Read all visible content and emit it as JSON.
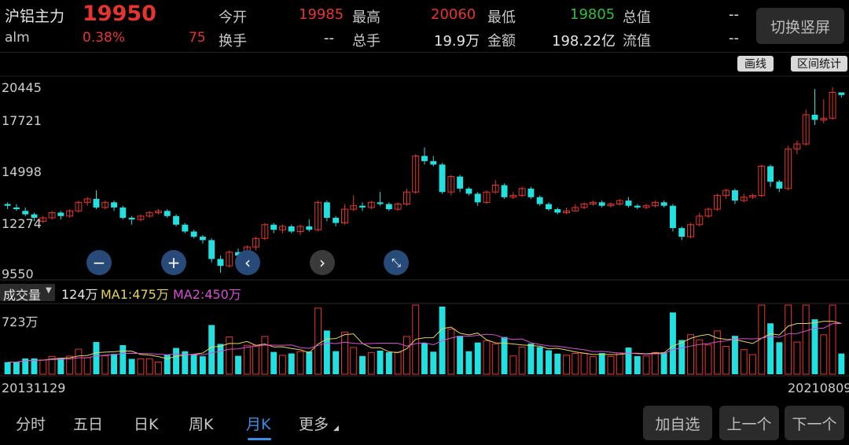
{
  "header": {
    "name": "沪铝主力",
    "price": "19950",
    "code": "alm",
    "change_pct": "0.38%",
    "change_val": "75",
    "switch_label": "切换竖屏"
  },
  "stats": {
    "open_label": "今开",
    "open": "19985",
    "high_label": "最高",
    "high": "20060",
    "low_label": "最低",
    "low": "19805",
    "total_value_label": "总值",
    "total_value": "--",
    "turnover_label": "换手",
    "turnover": "--",
    "total_hand_label": "总手",
    "total_hand": "19.9万",
    "amount_label": "金额",
    "amount": "198.22亿",
    "float_value_label": "流值",
    "float_value": "--"
  },
  "tools": {
    "draw": "画线",
    "range": "区间统计"
  },
  "volume_bar": {
    "selector": "成交量",
    "vol": "124万",
    "ma1": "MA1:475万",
    "ma2": "MA2:450万"
  },
  "y_ticks": [
    "20445",
    "17721",
    "14998",
    "12274",
    "9550"
  ],
  "vol_tick": "723万",
  "date_start": "20131129",
  "date_end": "20210809",
  "tabs": [
    "分时",
    "五日",
    "日K",
    "周K",
    "月K",
    "更多"
  ],
  "actions": {
    "add_watch": "加自选",
    "prev": "上一个",
    "next": "下一个"
  },
  "colors": {
    "up": "#e8342f",
    "down": "#22e0e0",
    "ma1": "#e6d35a",
    "ma2": "#d94fd6",
    "active_tab": "#3a8ee6"
  },
  "icons": [
    "minus-icon",
    "plus-icon",
    "chevron-left-icon",
    "chevron-right-icon",
    "collapse-icon"
  ],
  "chart_data": {
    "type": "candlestick",
    "y_range": [
      9550,
      20445
    ],
    "candles": [
      [
        13600,
        13500,
        13700,
        13300
      ],
      [
        13400,
        13300,
        13600,
        13200
      ],
      [
        13200,
        13000,
        13400,
        12900
      ],
      [
        13000,
        12800,
        13100,
        12600
      ],
      [
        12600,
        12800,
        12900,
        12500
      ],
      [
        12800,
        13100,
        13200,
        12700
      ],
      [
        13100,
        12900,
        13200,
        12700
      ],
      [
        12900,
        13200,
        13300,
        12800
      ],
      [
        13200,
        13700,
        13800,
        13100
      ],
      [
        13700,
        13900,
        14000,
        13500
      ],
      [
        13900,
        13400,
        14400,
        13300
      ],
      [
        13400,
        13700,
        13800,
        13300
      ],
      [
        13700,
        13400,
        13800,
        13200
      ],
      [
        13400,
        12800,
        13500,
        12700
      ],
      [
        12800,
        12700,
        12900,
        12400
      ],
      [
        12700,
        12900,
        13000,
        12600
      ],
      [
        12900,
        13100,
        13200,
        12800
      ],
      [
        13100,
        13200,
        13300,
        13000
      ],
      [
        13200,
        12900,
        13300,
        12800
      ],
      [
        12900,
        12400,
        13000,
        12300
      ],
      [
        12400,
        12000,
        12500,
        11900
      ],
      [
        12000,
        11700,
        12100,
        11600
      ],
      [
        11700,
        11500,
        11800,
        11300
      ],
      [
        11500,
        10400,
        11600,
        10200
      ],
      [
        10400,
        10000,
        10600,
        9600
      ],
      [
        10000,
        10800,
        10900,
        9900
      ],
      [
        10800,
        10600,
        11000,
        10500
      ],
      [
        10600,
        11100,
        11200,
        10400
      ],
      [
        11100,
        11600,
        11700,
        10900
      ],
      [
        11600,
        12400,
        12500,
        11500
      ],
      [
        12400,
        12100,
        12500,
        11900
      ],
      [
        12100,
        12300,
        12400,
        11900
      ],
      [
        12300,
        12000,
        12400,
        11900
      ],
      [
        12000,
        12300,
        12400,
        11800
      ],
      [
        12300,
        12100,
        12700,
        12000
      ],
      [
        12100,
        13700,
        13800,
        12000
      ],
      [
        13700,
        12800,
        13800,
        12600
      ],
      [
        12800,
        12500,
        12900,
        12300
      ],
      [
        12500,
        13300,
        13600,
        12400
      ],
      [
        13300,
        13500,
        14100,
        13200
      ],
      [
        13500,
        13400,
        13700,
        13200
      ],
      [
        13400,
        13700,
        13800,
        13300
      ],
      [
        13700,
        13600,
        14300,
        13500
      ],
      [
        13600,
        13300,
        13700,
        13200
      ],
      [
        13300,
        13600,
        13700,
        13200
      ],
      [
        13600,
        14300,
        14500,
        13500
      ],
      [
        14300,
        16400,
        16500,
        14200
      ],
      [
        16400,
        16100,
        16900,
        15900
      ],
      [
        16100,
        15900,
        16400,
        15800
      ],
      [
        15900,
        14300,
        16000,
        14200
      ],
      [
        14300,
        15200,
        15300,
        14100
      ],
      [
        15200,
        14500,
        15300,
        14300
      ],
      [
        14500,
        14200,
        14600,
        14100
      ],
      [
        14200,
        13700,
        14300,
        13500
      ],
      [
        13700,
        14300,
        14400,
        13600
      ],
      [
        14300,
        14700,
        15000,
        14200
      ],
      [
        14700,
        14000,
        14800,
        13900
      ],
      [
        14000,
        14100,
        14300,
        13900
      ],
      [
        14100,
        14500,
        14600,
        14000
      ],
      [
        14500,
        14000,
        14600,
        13900
      ],
      [
        14000,
        13600,
        14100,
        13500
      ],
      [
        13600,
        13300,
        13700,
        13200
      ],
      [
        13300,
        13100,
        13400,
        13000
      ],
      [
        13100,
        13200,
        13400,
        13000
      ],
      [
        13200,
        13400,
        13600,
        13200
      ],
      [
        13400,
        13600,
        13700,
        13300
      ],
      [
        13600,
        13700,
        13800,
        13500
      ],
      [
        13700,
        13500,
        13800,
        13400
      ],
      [
        13500,
        13600,
        13700,
        13400
      ],
      [
        13600,
        13800,
        13900,
        13500
      ],
      [
        13800,
        13500,
        14000,
        13400
      ],
      [
        13500,
        13400,
        13600,
        13300
      ],
      [
        13400,
        13500,
        13600,
        13300
      ],
      [
        13500,
        13700,
        13800,
        13400
      ],
      [
        13700,
        13500,
        13800,
        13400
      ],
      [
        13500,
        12200,
        13600,
        12000
      ],
      [
        12200,
        11700,
        12300,
        11500
      ],
      [
        11700,
        12400,
        12500,
        11600
      ],
      [
        12400,
        12900,
        13100,
        12300
      ],
      [
        12900,
        13300,
        13400,
        12800
      ],
      [
        13300,
        14100,
        14200,
        13200
      ],
      [
        14100,
        14400,
        14500,
        13900
      ],
      [
        14400,
        13800,
        14500,
        13600
      ],
      [
        13800,
        14000,
        14200,
        13700
      ],
      [
        14000,
        14100,
        14200,
        13900
      ],
      [
        14100,
        15800,
        15900,
        14000
      ],
      [
        15800,
        14900,
        15900,
        14600
      ],
      [
        14900,
        14500,
        15000,
        14300
      ],
      [
        14500,
        16800,
        17000,
        14400
      ],
      [
        16800,
        17100,
        17300,
        16500
      ],
      [
        17100,
        18800,
        19100,
        17000
      ],
      [
        18800,
        18500,
        20300,
        18200
      ],
      [
        18500,
        18600,
        19700,
        18300
      ],
      [
        18600,
        20100,
        20400,
        18500
      ],
      [
        20100,
        19950,
        20060,
        19805
      ]
    ],
    "ma1": "MA1:475万",
    "ma2": "MA2:450万"
  }
}
